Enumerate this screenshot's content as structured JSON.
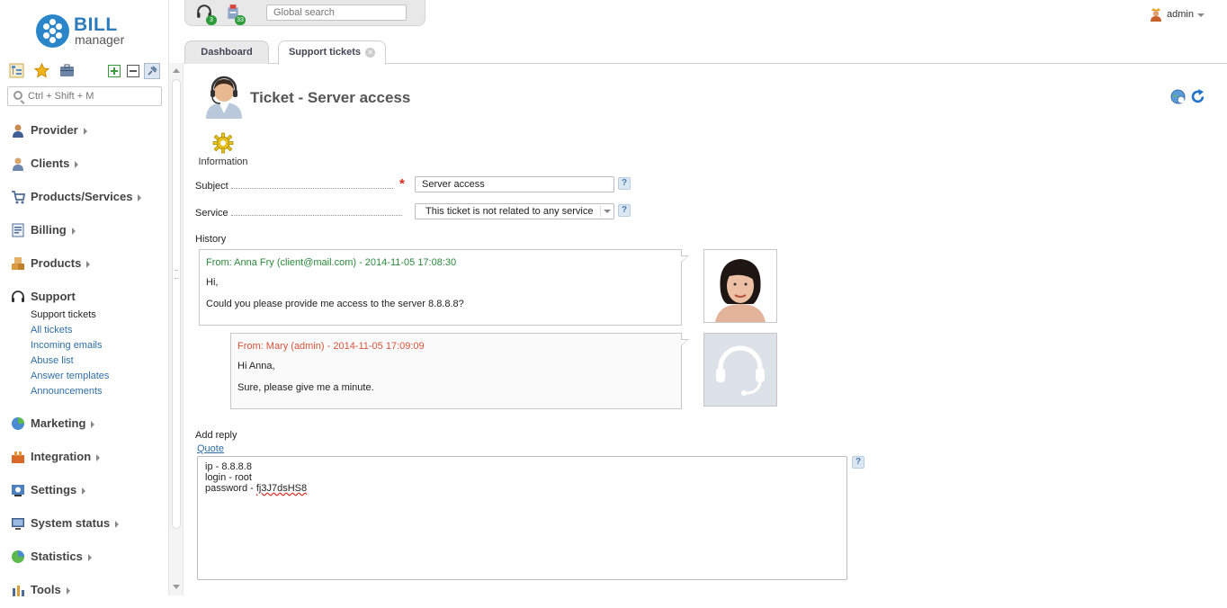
{
  "app": {
    "logo_main": "BILL",
    "logo_sub": "manager",
    "user_name": "admin"
  },
  "colors": {
    "brand_blue": "#2b86c9",
    "link": "#2e6ea6",
    "client_msg": "#2a8a3b",
    "support_msg": "#d9533b",
    "required": "#e0261b",
    "badge": "#2c9b3a"
  },
  "topbar": {
    "notifications": [
      {
        "icon": "headset-icon",
        "count": "3"
      },
      {
        "icon": "ticket-alert-icon",
        "count": "33"
      }
    ],
    "search_placeholder": "Global search"
  },
  "sidebar": {
    "search_placeholder": "Ctrl + Shift + M",
    "tools": [
      "tree-icon",
      "star-icon",
      "briefcase-icon",
      "expand-all-icon",
      "collapse-all-icon",
      "pin-icon"
    ],
    "menu": [
      {
        "label": "Provider",
        "icon": "provider-icon"
      },
      {
        "label": "Clients",
        "icon": "clients-icon"
      },
      {
        "label": "Products/Services",
        "icon": "cart-icon"
      },
      {
        "label": "Billing",
        "icon": "billing-icon"
      },
      {
        "label": "Products",
        "icon": "products-icon"
      },
      {
        "label": "Support",
        "icon": "support-headset-icon"
      },
      {
        "label": "Marketing",
        "icon": "pie-chart-icon"
      },
      {
        "label": "Integration",
        "icon": "integration-icon"
      },
      {
        "label": "Settings",
        "icon": "settings-icon"
      },
      {
        "label": "System status",
        "icon": "monitor-icon"
      },
      {
        "label": "Statistics",
        "icon": "statistics-icon"
      },
      {
        "label": "Tools",
        "icon": "tools-icon"
      }
    ],
    "support_submenu": [
      "Support tickets",
      "All tickets",
      "Incoming emails",
      "Abuse list",
      "Answer templates",
      "Announcements"
    ]
  },
  "tabs": [
    {
      "label": "Dashboard",
      "active": false
    },
    {
      "label": "Support tickets",
      "active": true,
      "closable": true
    }
  ],
  "page": {
    "title": "Ticket - Server access",
    "head_tools": [
      "globe-refresh-icon",
      "refresh-icon"
    ],
    "info_button": "Information",
    "subject_label": "Subject",
    "subject_value": "Server access",
    "service_label": "Service",
    "service_value": "This ticket is not related to any service",
    "history_label": "History",
    "messages": [
      {
        "from": "From: Anna Fry (client@mail.com) - 2014-11-05 17:08:30",
        "lines": [
          "Hi,",
          "Could you please provide me access to the server 8.8.8.8?"
        ],
        "role": "client"
      },
      {
        "from": "From: Mary (admin) - 2014-11-05 17:09:09",
        "lines": [
          "Hi Anna,",
          "Sure, please give me a minute."
        ],
        "role": "support"
      }
    ],
    "add_reply_label": "Add reply",
    "quote_link": "Quote",
    "reply_lines": [
      "ip - 8.8.8.8",
      "login - root",
      "password - "
    ],
    "reply_password": "fj3J7dsHS8",
    "help_glyph": "?"
  }
}
